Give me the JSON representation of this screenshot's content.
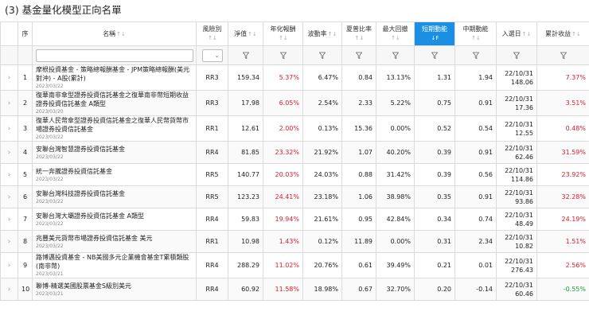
{
  "page": {
    "title": "(3) 基金量化模型正向名單"
  },
  "colors": {
    "active_header": "#1a8fe3",
    "positive": "#d6202f",
    "negative": "#1b9e3e"
  },
  "columns": {
    "index": "序",
    "name": "名稱",
    "risk": "風險別",
    "nav": "淨值",
    "annual_return": "年化報酬",
    "volatility": "波動率",
    "sharpe": "夏普比率",
    "max_drawdown": "最大回撤",
    "short_momentum": "短期動能",
    "mid_momentum": "中期動能",
    "entry_date": "入選日",
    "cumulative_return": "累計收益"
  },
  "sort_icons": {
    "default": "↑↓",
    "active": "↓F"
  },
  "icons": {
    "expand": "chevron-right-icon",
    "filter": "funnel-icon",
    "dropdown": "chevron-down-icon"
  },
  "glyphs": {
    "expand": "›",
    "dropdown": "⌄"
  },
  "rows": [
    {
      "index": "1",
      "name": "摩根投資基金 - 策略總報酬基金 - JPM策略總報酬(美元對沖) - A股(累計)",
      "date": "2023/03/22",
      "risk": "RR3",
      "nav": "159.34",
      "annual_return": "5.37%",
      "volatility": "6.47%",
      "sharpe": "0.84",
      "max_drawdown": "13.13%",
      "short_momentum": "1.31",
      "mid_momentum": "1.94",
      "entry_date": "22/10/31",
      "entry_value": "148.06",
      "cumulative_return": "7.37%",
      "cum_sign": "pos"
    },
    {
      "index": "2",
      "name": "復華南非傘型證券投資信託基金之復華南非幣短期收益證券投資信託基金 A類型",
      "date": "2023/03/20",
      "risk": "RR3",
      "nav": "17.98",
      "annual_return": "6.05%",
      "volatility": "2.54%",
      "sharpe": "2.33",
      "max_drawdown": "5.22%",
      "short_momentum": "0.75",
      "mid_momentum": "0.91",
      "entry_date": "22/10/31",
      "entry_value": "17.36",
      "cumulative_return": "3.51%",
      "cum_sign": "pos"
    },
    {
      "index": "3",
      "name": "復華人民幣傘型證券投資信託基金之復華人民幣貨幣市場證券投資信託基金",
      "date": "2023/03/22",
      "risk": "RR1",
      "nav": "12.61",
      "annual_return": "2.00%",
      "volatility": "0.13%",
      "sharpe": "15.36",
      "max_drawdown": "0.00%",
      "short_momentum": "0.52",
      "mid_momentum": "0.54",
      "entry_date": "22/10/31",
      "entry_value": "12.55",
      "cumulative_return": "0.48%",
      "cum_sign": "pos"
    },
    {
      "index": "4",
      "name": "安聯台灣智慧證券投資信託基金",
      "date": "2023/03/22",
      "risk": "RR4",
      "nav": "81.85",
      "annual_return": "23.32%",
      "volatility": "21.92%",
      "sharpe": "1.07",
      "max_drawdown": "40.20%",
      "short_momentum": "0.39",
      "mid_momentum": "0.91",
      "entry_date": "22/10/31",
      "entry_value": "62.46",
      "cumulative_return": "31.59%",
      "cum_sign": "pos"
    },
    {
      "index": "5",
      "name": "統一奔騰證券投資信託基金",
      "date": "2023/03/22",
      "risk": "RR5",
      "nav": "140.77",
      "annual_return": "20.03%",
      "volatility": "24.03%",
      "sharpe": "0.88",
      "max_drawdown": "31.42%",
      "short_momentum": "0.39",
      "mid_momentum": "0.56",
      "entry_date": "22/10/31",
      "entry_value": "114.86",
      "cumulative_return": "23.92%",
      "cum_sign": "pos"
    },
    {
      "index": "6",
      "name": "安聯台灣科技證券投資信託基金",
      "date": "2023/03/22",
      "risk": "RR5",
      "nav": "123.23",
      "annual_return": "24.41%",
      "volatility": "23.18%",
      "sharpe": "1.06",
      "max_drawdown": "38.98%",
      "short_momentum": "0.35",
      "mid_momentum": "0.91",
      "entry_date": "22/10/31",
      "entry_value": "93.86",
      "cumulative_return": "32.28%",
      "cum_sign": "pos"
    },
    {
      "index": "7",
      "name": "安聯台灣大壩證券投資信託基金 A類型",
      "date": "2023/03/22",
      "risk": "RR4",
      "nav": "59.83",
      "annual_return": "19.94%",
      "volatility": "21.61%",
      "sharpe": "0.95",
      "max_drawdown": "42.84%",
      "short_momentum": "0.34",
      "mid_momentum": "0.74",
      "entry_date": "22/10/31",
      "entry_value": "48.49",
      "cumulative_return": "24.19%",
      "cum_sign": "pos"
    },
    {
      "index": "8",
      "name": "兆豐美元貨幣市場證券投資信託基金 美元",
      "date": "2023/03/22",
      "risk": "RR1",
      "nav": "10.98",
      "annual_return": "1.43%",
      "volatility": "0.12%",
      "sharpe": "11.89",
      "max_drawdown": "0.00%",
      "short_momentum": "0.31",
      "mid_momentum": "2.34",
      "entry_date": "22/10/31",
      "entry_value": "10.82",
      "cumulative_return": "1.51%",
      "cum_sign": "pos"
    },
    {
      "index": "9",
      "name": "路博邁投資基金 - NB美國多元企業機會基金T累積類股(南非幣)",
      "date": "2023/03/21",
      "risk": "RR4",
      "nav": "288.29",
      "annual_return": "11.02%",
      "volatility": "20.76%",
      "sharpe": "0.61",
      "max_drawdown": "39.49%",
      "short_momentum": "0.21",
      "mid_momentum": "0.01",
      "entry_date": "22/10/31",
      "entry_value": "276.43",
      "cumulative_return": "2.56%",
      "cum_sign": "pos"
    },
    {
      "index": "10",
      "name": "聯博-精選美國股票基金S級別美元",
      "date": "2023/03/21",
      "risk": "RR4",
      "nav": "60.92",
      "annual_return": "11.58%",
      "volatility": "18.98%",
      "sharpe": "0.67",
      "max_drawdown": "32.70%",
      "short_momentum": "0.20",
      "mid_momentum": "-0.14",
      "entry_date": "22/10/31",
      "entry_value": "60.46",
      "cumulative_return": "-0.55%",
      "cum_sign": "neg"
    }
  ]
}
